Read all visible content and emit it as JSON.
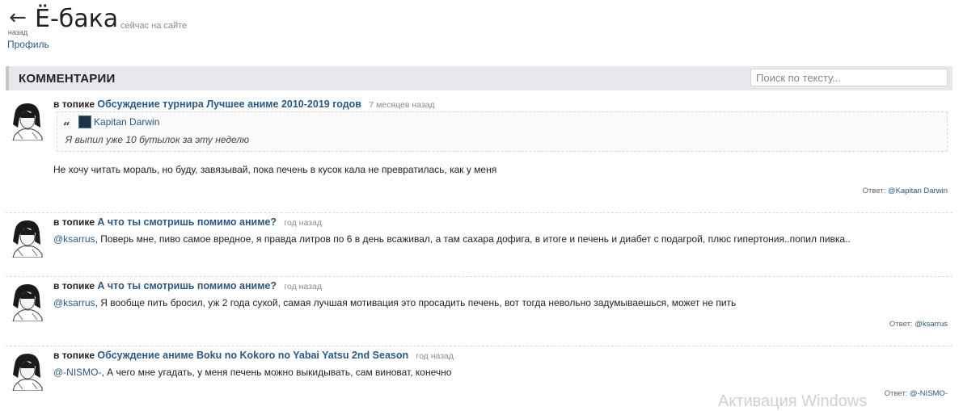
{
  "header": {
    "back_icon": "left-arrow-icon",
    "back_label": "назад",
    "username": "Ё-бака",
    "status": "сейчас на сайте",
    "profile_link": "Профиль"
  },
  "comments_section": {
    "title": "КОММЕНТАРИИ",
    "search_placeholder": "Поиск по тексту..."
  },
  "comments": [
    {
      "in_topic": "в топике",
      "topic": "Обсуждение турнира Лучшее аниме 2010-2019 годов",
      "time": "7 месяцев назад",
      "quote": {
        "author": "Kapitan Darwin",
        "text": "Я выпил уже 10 бутылок за эту неделю"
      },
      "mention": "",
      "text": "Не хочу читать мораль, но буду, завязывай, пока печень в кусок кала не превратилась, как у меня",
      "reply_label": "Ответ:",
      "reply_to": "@Kapitan Darwin"
    },
    {
      "in_topic": "в топике",
      "topic": "А что ты смотришь помимо аниме?",
      "time": "год назад",
      "mention": "@ksarrus",
      "text": ", Поверь мне, пиво самое вредное, я правда литров по 6 в день всаживал, а там сахара дофига, в итоге и печень и диабет с подагрой, плюс гипертония..попил пивка.."
    },
    {
      "in_topic": "в топике",
      "topic": "А что ты смотришь помимо аниме?",
      "time": "год назад",
      "mention": "@ksarrus",
      "text": ", Я вообще пить бросил, уж 2 года сухой, самая лучшая мотивация это просадить печень, вот тогда невольно задумываешься, может не пить",
      "reply_label": "Ответ:",
      "reply_to": "@ksarrus"
    },
    {
      "in_topic": "в топике",
      "topic": "Обсуждение аниме Boku no Kokoro no Yabai Yatsu 2nd Season",
      "time": "год назад",
      "mention": "@-NISMO-",
      "text": ", А чего мне угадать, у меня печень можно выкидывать, сам виноват, конечно",
      "reply_label": "Ответ:",
      "reply_to": "@-NISMO-"
    }
  ],
  "watermark": "Активация Windows"
}
